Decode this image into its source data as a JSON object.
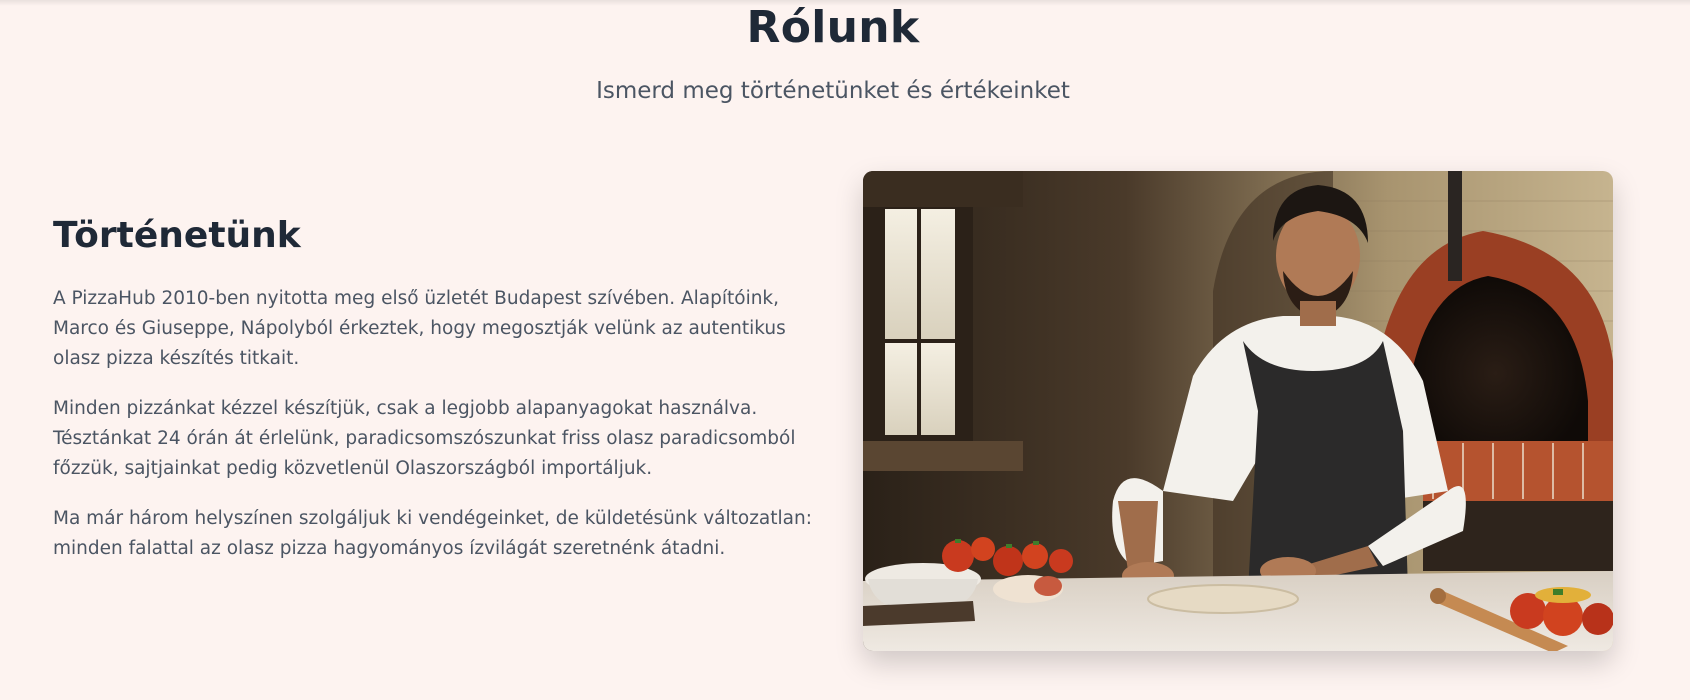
{
  "about": {
    "title": "Rólunk",
    "subtitle": "Ismerd meg történetünket és értékeinket"
  },
  "story": {
    "heading": "Történetünk",
    "paragraphs": [
      "A PizzaHub 2010-ben nyitotta meg első üzletét Budapest szívében. Alapítóink, Marco és Giuseppe, Nápolyból érkeztek, hogy megosztják velünk az autentikus olasz pizza készítés titkait.",
      "Minden pizzánkat kézzel készítjük, csak a legjobb alapanyagokat használva. Tésztánkat 24 órán át érlelünk, paradicsomszószunkat friss olasz paradicsomból főzzük, sajtjainkat pedig közvetlenül Olaszországból importáljuk.",
      "Ma már három helyszínen szolgáljuk ki vendégeinket, de küldetésünk változatlan: minden falattal az olasz pizza hagyományos ízvilágát szeretnénk átadni."
    ]
  },
  "colors": {
    "background": "#fdf3f0",
    "heading": "#1f2937",
    "body_text": "#4b5563"
  }
}
